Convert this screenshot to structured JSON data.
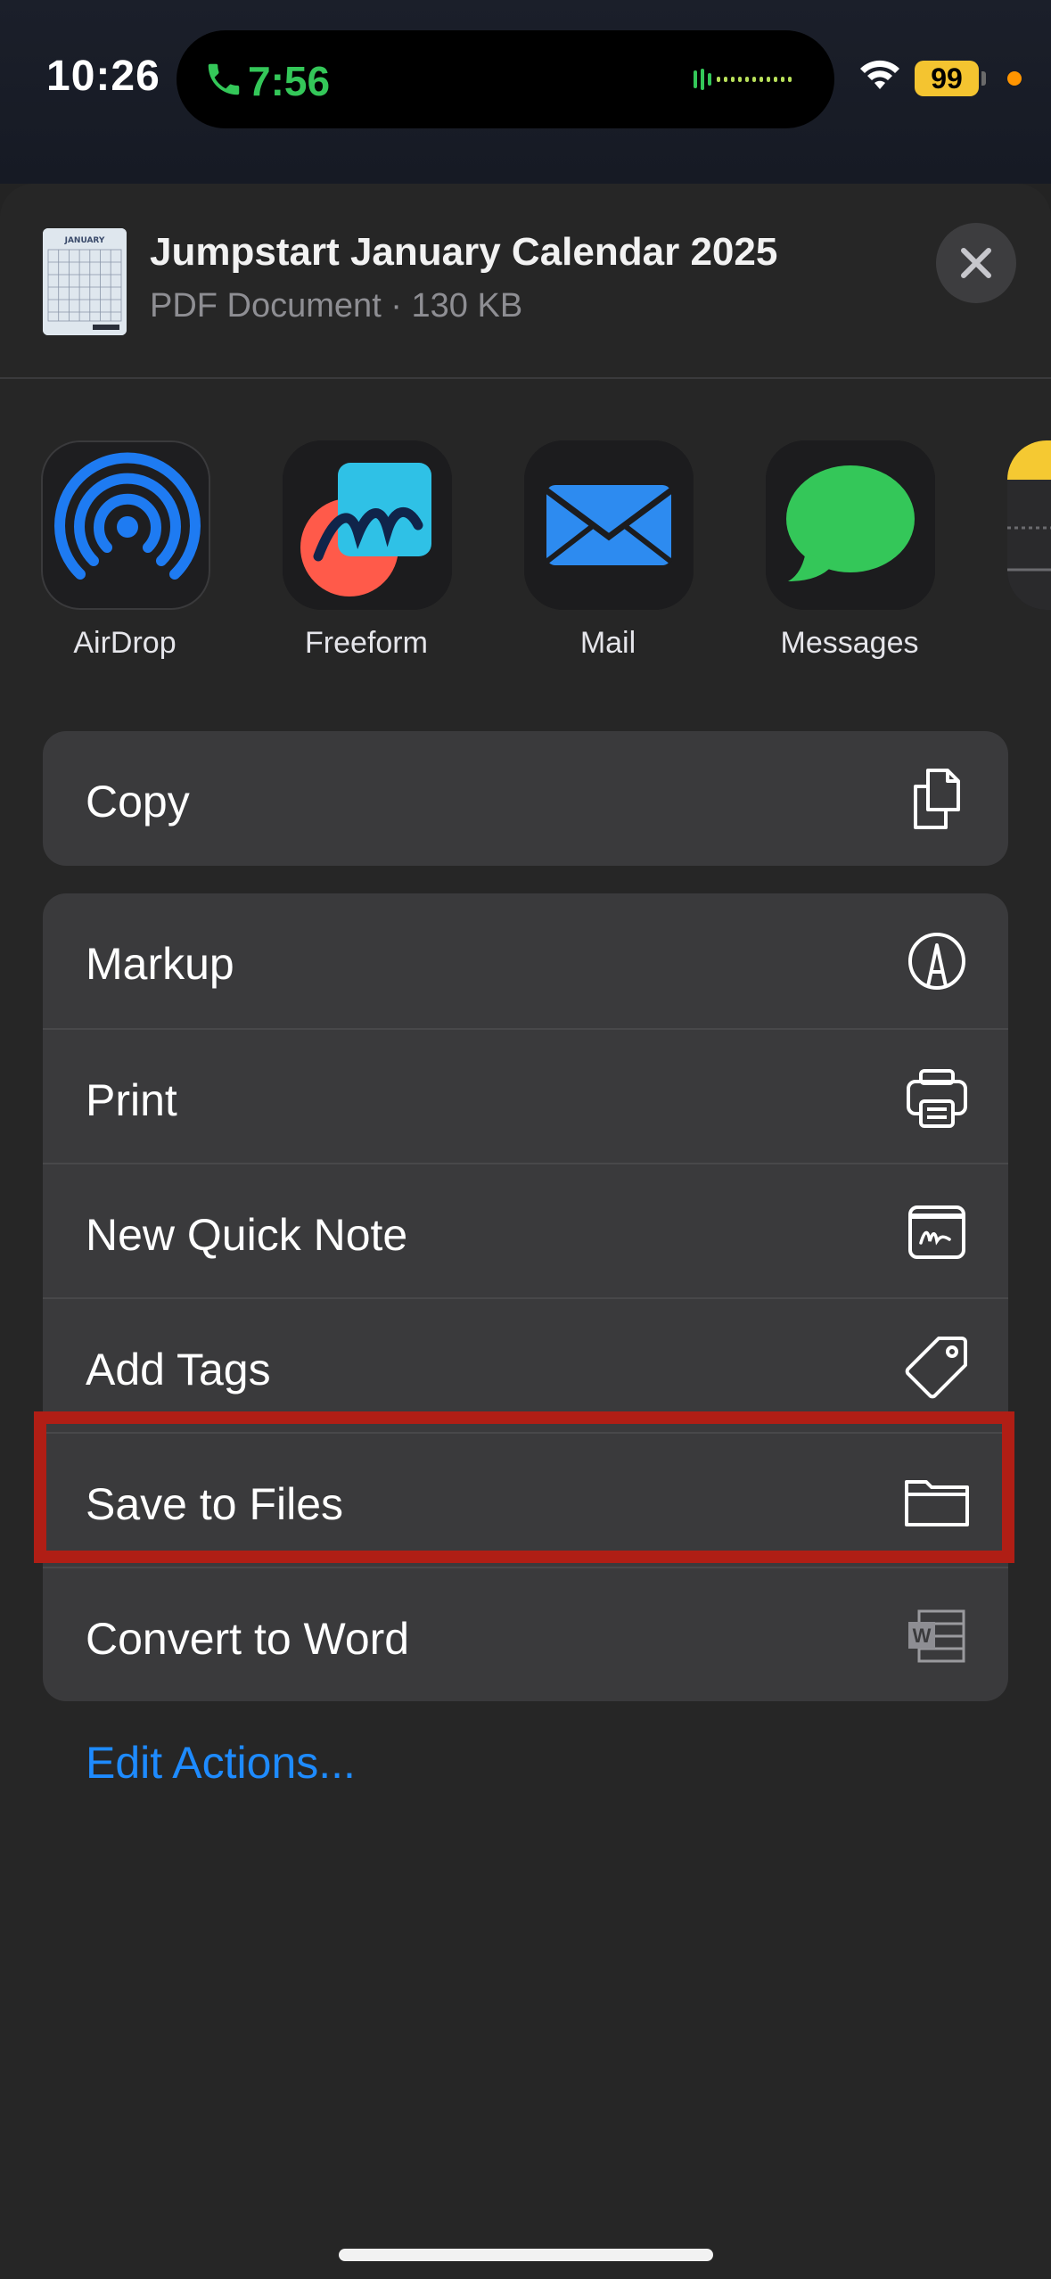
{
  "status_bar": {
    "time": "10:26",
    "call_duration": "7:56",
    "battery_level": "99"
  },
  "sheet": {
    "document": {
      "title": "Jumpstart January Calendar 2025",
      "subtitle": "PDF Document · 130 KB",
      "thumbnail_label": "JANUARY"
    },
    "apps": [
      {
        "label": "AirDrop",
        "icon": "airdrop-icon"
      },
      {
        "label": "Freeform",
        "icon": "freeform-icon"
      },
      {
        "label": "Mail",
        "icon": "mail-icon"
      },
      {
        "label": "Messages",
        "icon": "messages-icon"
      },
      {
        "label": "",
        "icon": "notes-icon"
      }
    ],
    "primary_actions": [
      {
        "label": "Copy",
        "icon": "copy-icon"
      }
    ],
    "actions": [
      {
        "label": "Markup",
        "icon": "markup-icon"
      },
      {
        "label": "Print",
        "icon": "printer-icon"
      },
      {
        "label": "New Quick Note",
        "icon": "quick-note-icon"
      },
      {
        "label": "Add Tags",
        "icon": "tag-icon"
      },
      {
        "label": "Save to Files",
        "icon": "folder-icon",
        "highlighted": true
      },
      {
        "label": "Convert to Word",
        "icon": "word-icon"
      }
    ],
    "edit_actions_label": "Edit Actions..."
  },
  "colors": {
    "sheet_background": "#262626",
    "group_background": "#3a3a3c",
    "link_blue": "#1e8bff",
    "highlight_red": "#b01e15",
    "call_green": "#34c759",
    "battery_yellow": "#f4c430"
  }
}
